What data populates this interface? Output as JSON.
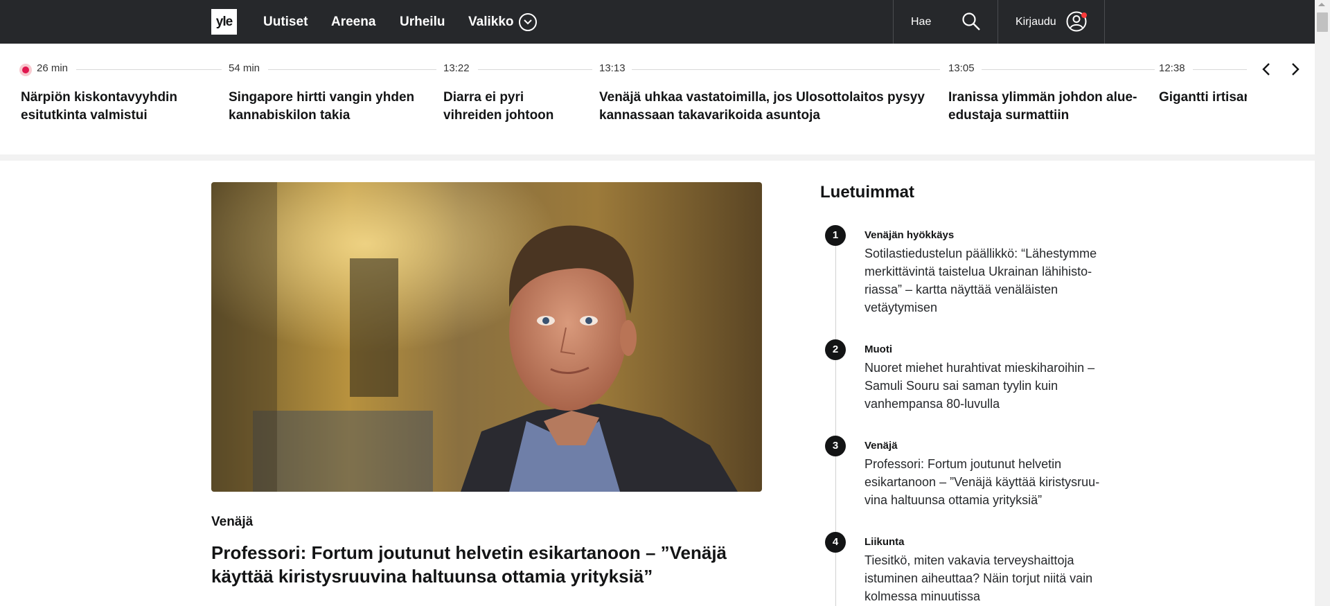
{
  "header": {
    "logo": "yle",
    "nav": [
      "Uutiset",
      "Areena",
      "Urheilu",
      "Valikko"
    ],
    "search_label": "Hae",
    "login_label": "Kirjaudu"
  },
  "ticker": {
    "items": [
      {
        "time": "26 min",
        "title": "Närpiön kiskontavyyhdin esitutkinta valmistui",
        "live": true
      },
      {
        "time": "54 min",
        "title": "Singapore hirtti vangin yhden kannabiskilon takia"
      },
      {
        "time": "13:22",
        "title": "Diarra ei pyri vihreiden johtoon"
      },
      {
        "time": "13:13",
        "title": "Venäjä uhkaa vastatoimilla, jos Ulosottolaitos pysyy kannassaan takavarikoida asuntoja"
      },
      {
        "time": "13:05",
        "title": "Iranissa ylimmän johdon alue­edustaja surmattiin"
      },
      {
        "time": "12:38",
        "title": "Gigantti irtisanoo"
      }
    ]
  },
  "main": {
    "category": "Venäjä",
    "headline": "Professori: Fortum joutunut helvetin esikartanoon – ”Venäjä käyttää kiristysruuvina haltuunsa ottamia yrityksiä”"
  },
  "most_read": {
    "title": "Luetuimmat",
    "items": [
      {
        "num": "1",
        "category": "Venäjän hyökkäys",
        "text": "Sotilastiedustelun päällikkö: “Lähestymme merkittävintä taistelua Ukrainan lähihisto­riassa” – kartta näyttää venäläisten vetäytymisen"
      },
      {
        "num": "2",
        "category": "Muoti",
        "text": "Nuoret miehet hurahtivat mieskiharoihin – Samuli Souru sai saman tyylin kuin vanhempansa 80-luvulla"
      },
      {
        "num": "3",
        "category": "Venäjä",
        "text": "Professori: Fortum joutunut helvetin esikartanoon – ”Venäjä käyttää kiristysruu­vina haltuunsa ottamia yrityksiä”"
      },
      {
        "num": "4",
        "category": "Liikunta",
        "text": "Tiesitkö, miten vakavia terveyshaittoja istuminen aiheuttaa? Näin torjut niitä vain kolmessa minuutissa"
      }
    ]
  }
}
